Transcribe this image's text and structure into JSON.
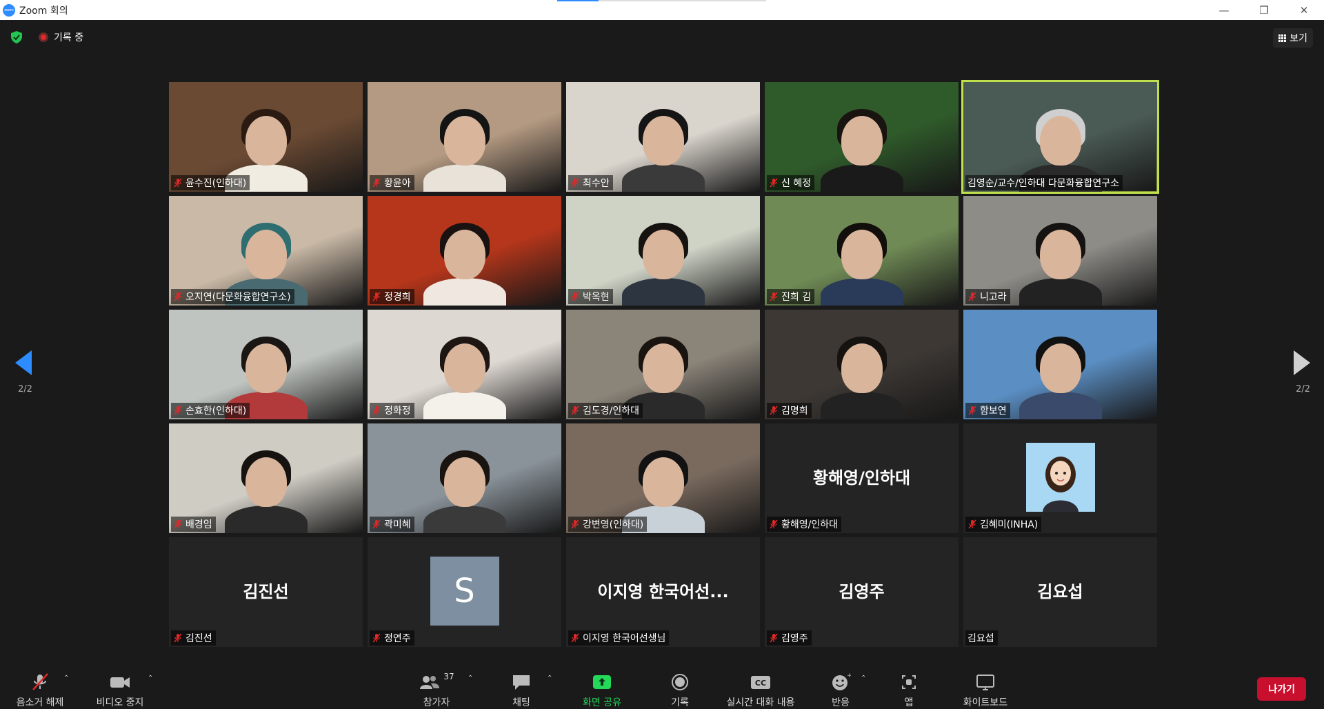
{
  "window": {
    "title": "Zoom 회의",
    "app_icon_text": "zoom"
  },
  "topbar": {
    "recording_label": "기록 중",
    "view_label": "보기"
  },
  "pagination": {
    "left": "2/2",
    "right": "2/2"
  },
  "participants": [
    {
      "name": "윤수진(인하대)",
      "muted": true,
      "video": true,
      "bg": "#6b4a33",
      "body": "#f1ece1",
      "hair": "#2a1a12"
    },
    {
      "name": "황윤아",
      "muted": true,
      "video": true,
      "bg": "#b49a82",
      "body": "#e8e2d8",
      "hair": "#141414"
    },
    {
      "name": "최수안",
      "muted": true,
      "video": true,
      "bg": "#d9d4cc",
      "body": "#3a3a3a",
      "hair": "#151515"
    },
    {
      "name": "신 혜정",
      "muted": true,
      "video": true,
      "bg": "#2f5a2a",
      "body": "#1a1a1a",
      "hair": "#1a1410"
    },
    {
      "name": "김영순/교수/인하대 다문화융합연구소",
      "muted": false,
      "video": true,
      "active": true,
      "bg": "#4a5a55",
      "body": "#2a2a2a",
      "hair": "#cfcfcf"
    },
    {
      "name": "오지연(다문화융합연구소)",
      "muted": true,
      "video": true,
      "bg": "#c9b9a6",
      "body": "#4a6a72",
      "hair": "#2e6d70"
    },
    {
      "name": "정경희",
      "muted": true,
      "video": true,
      "bg": "#b5361b",
      "body": "#f0e8e0",
      "hair": "#1a1210"
    },
    {
      "name": "박옥현",
      "muted": true,
      "video": true,
      "bg": "#cfd3c6",
      "body": "#2d3540",
      "hair": "#161210"
    },
    {
      "name": "진희 김",
      "muted": true,
      "video": true,
      "bg": "#6f8a55",
      "body": "#2a3b5a",
      "hair": "#120e0c"
    },
    {
      "name": "니고라",
      "muted": true,
      "video": true,
      "bg": "#8d8c87",
      "body": "#222",
      "hair": "#151212"
    },
    {
      "name": "손효한(인하대)",
      "muted": true,
      "video": true,
      "bg": "#bfc4c0",
      "body": "#b33a3a",
      "hair": "#1a1614"
    },
    {
      "name": "정화정",
      "muted": true,
      "video": true,
      "bg": "#ded8d2",
      "body": "#f4f0ea",
      "hair": "#1e1612"
    },
    {
      "name": "김도경/인하대",
      "muted": true,
      "video": true,
      "bg": "#8b8479",
      "body": "#2a2a2a",
      "hair": "#1a1410"
    },
    {
      "name": "김명희",
      "muted": true,
      "video": true,
      "bg": "#3d3834",
      "body": "#222",
      "hair": "#151210"
    },
    {
      "name": "함보연",
      "muted": true,
      "video": true,
      "bg": "#5b8fc4",
      "body": "#3a4a6a",
      "hair": "#111"
    },
    {
      "name": "배경임",
      "muted": true,
      "video": true,
      "bg": "#cfccc4",
      "body": "#2a2a2a",
      "hair": "#151210"
    },
    {
      "name": "곽미혜",
      "muted": true,
      "video": true,
      "bg": "#8a939a",
      "body": "#3a3a3a",
      "hair": "#1a1410"
    },
    {
      "name": "강변영(인하대)",
      "muted": true,
      "video": true,
      "bg": "#7a6a5e",
      "body": "#c8d0d8",
      "hair": "#121212"
    },
    {
      "name": "황해영/인하대",
      "muted": true,
      "video": false,
      "display": "황해영/인하대"
    },
    {
      "name": "김혜미(INHA)",
      "muted": true,
      "video": false,
      "avatar": "cartoon"
    },
    {
      "name": "김진선",
      "muted": true,
      "video": false,
      "display": "김진선"
    },
    {
      "name": "정연주",
      "muted": true,
      "video": false,
      "avatar": "S"
    },
    {
      "name": "이지영 한국어선생님",
      "muted": true,
      "video": false,
      "display": "이지영 한국어선..."
    },
    {
      "name": "김영주",
      "muted": true,
      "video": false,
      "display": "김영주"
    },
    {
      "name": "김요섭",
      "muted": false,
      "video": false,
      "display": "김요섭"
    }
  ],
  "toolbar": {
    "unmute": "음소거 해제",
    "stop_video": "비디오 중지",
    "participants": "참가자",
    "participant_count": "37",
    "chat": "채팅",
    "share_screen": "화면 공유",
    "record": "기록",
    "live_transcript": "실시간 대화 내용",
    "cc_text": "CC",
    "reactions": "반응",
    "apps": "앱",
    "whiteboard": "화이트보드",
    "leave": "나가기"
  },
  "colors": {
    "accent": "#2d8cff",
    "active_speaker": "#bfe04a",
    "leave": "#c8102e",
    "share": "#23d959",
    "muted": "#e02828"
  }
}
